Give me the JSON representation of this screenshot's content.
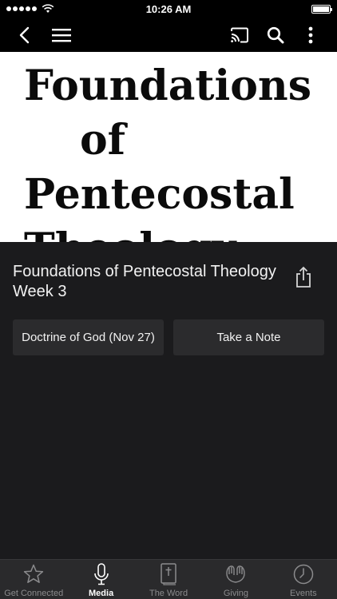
{
  "status_bar": {
    "time": "10:26 AM",
    "signal_bars": 5
  },
  "nav": {
    "back_icon": "chevron-left-icon",
    "menu_icon": "hamburger-menu-icon",
    "cast_icon": "cast-icon",
    "search_icon": "search-icon",
    "more_icon": "more-vertical-icon"
  },
  "hero": {
    "line1": "Foundations",
    "line2": "of",
    "line3": "Pentecostal",
    "line4": "Theology"
  },
  "media": {
    "title": "Foundations of Pentecostal Theology Week 3",
    "share_icon": "share-icon"
  },
  "buttons": {
    "primary_label": "Doctrine of God (Nov 27)",
    "note_label": "Take a Note"
  },
  "tabs": [
    {
      "label": "Get Connected",
      "icon": "star-icon",
      "active": false
    },
    {
      "label": "Media",
      "icon": "microphone-icon",
      "active": true
    },
    {
      "label": "The Word",
      "icon": "bible-icon",
      "active": false
    },
    {
      "label": "Giving",
      "icon": "hands-icon",
      "active": false
    },
    {
      "label": "Events",
      "icon": "clock-icon",
      "active": false
    }
  ],
  "colors": {
    "background": "#1b1b1d",
    "bar": "#000000",
    "button": "#2b2b2d",
    "tab_bar": "#2a2a2c",
    "inactive": "#8b8b8d"
  }
}
